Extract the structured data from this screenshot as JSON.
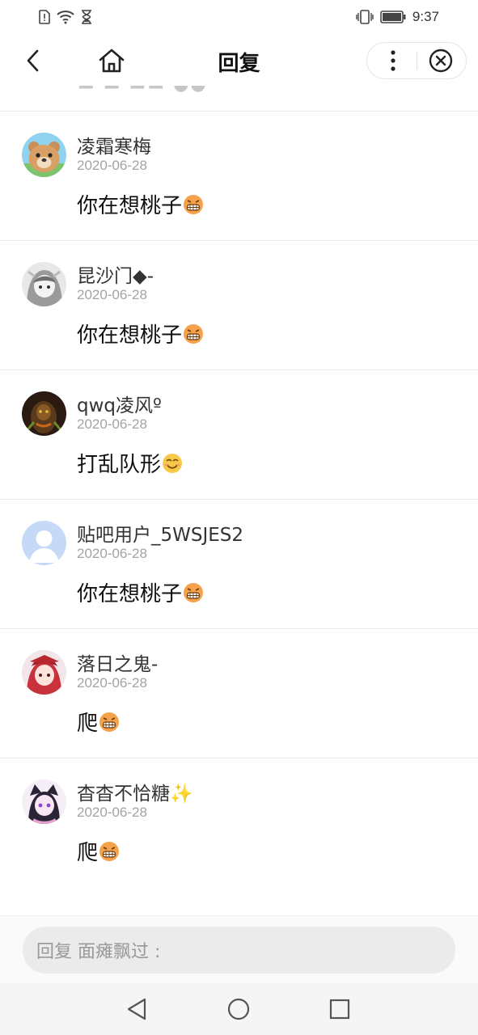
{
  "status_bar": {
    "time": "9:37"
  },
  "nav": {
    "title": "回复"
  },
  "replies": [
    {
      "username": "凌霜寒梅",
      "date": "2020-06-28",
      "content": "你在想桃子",
      "emoji": "grin-emoji"
    },
    {
      "username": "昆沙门◆-",
      "date": "2020-06-28",
      "content": "你在想桃子",
      "emoji": "grin-emoji"
    },
    {
      "username": "qwq凌风º",
      "date": "2020-06-28",
      "content": "打乱队形",
      "emoji": "smile-emoji"
    },
    {
      "username": "贴吧用户_5WSJES2",
      "date": "2020-06-28",
      "content": "你在想桃子",
      "emoji": "grin-emoji"
    },
    {
      "username": "落日之鬼-",
      "date": "2020-06-28",
      "content": "爬",
      "emoji": "grin-emoji"
    },
    {
      "username": "杳杳不恰糖",
      "username_suffix": "✨",
      "date": "2020-06-28",
      "content": "爬",
      "emoji": "grin-emoji"
    }
  ],
  "reply_bar": {
    "placeholder": "回复 面瘫飘过 :"
  },
  "colors": {
    "divider": "#ececec",
    "date": "#a3a3a3",
    "input_bg": "#ebebeb"
  }
}
